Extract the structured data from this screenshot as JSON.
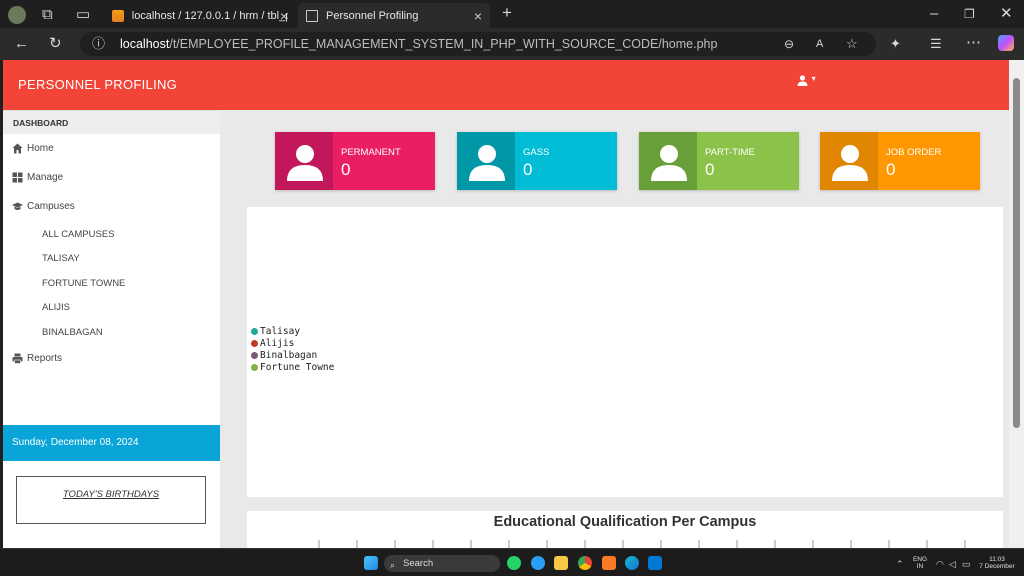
{
  "browser": {
    "tabs": [
      {
        "title": "localhost / 127.0.0.1 / hrm / tbl_p"
      },
      {
        "title": "Personnel Profiling"
      }
    ],
    "url_host": "localhost",
    "url_path": "/t/EMPLOYEE_PROFILE_MANAGEMENT_SYSTEM_IN_PHP_WITH_SOURCE_CODE/home.php"
  },
  "navbar": {
    "brand": "PERSONNEL PROFILING",
    "user_icon": "user-icon",
    "caret": "▾"
  },
  "sidebar": {
    "header": "DASHBOARD",
    "items": [
      {
        "label": "Home",
        "icon": "home-icon"
      },
      {
        "label": "Manage",
        "icon": "grid-icon"
      },
      {
        "label": "Campuses",
        "icon": "graduation-cap-icon"
      }
    ],
    "campuses": [
      "ALL CAMPUSES",
      "TALISAY",
      "FORTUNE TOWNE",
      "ALIJIS",
      "BINALBAGAN"
    ],
    "reports": {
      "label": "Reports",
      "icon": "printer-icon"
    },
    "date": "Sunday, December 08, 2024",
    "birthdays_label": "TODAY'S BIRTHDAYS"
  },
  "cards": [
    {
      "label": "PERMANENT",
      "count": "0",
      "color": "#e91e63",
      "dark": "#c2185b"
    },
    {
      "label": "GASS",
      "count": "0",
      "color": "#00bcd4",
      "dark": "#0097a7"
    },
    {
      "label": "PART-TIME",
      "count": "0",
      "color": "#8bc34a",
      "dark": "#689f38"
    },
    {
      "label": "JOB ORDER",
      "count": "0",
      "color": "#ff9800",
      "dark": "#e08600"
    }
  ],
  "chart1_legend": [
    {
      "name": "Talisay",
      "color": "#26a69a"
    },
    {
      "name": "Alijis",
      "color": "#c0392b"
    },
    {
      "name": "Binalbagan",
      "color": "#7b5a7a"
    },
    {
      "name": "Fortune Towne",
      "color": "#7cb342"
    }
  ],
  "chart_data": {
    "type": "bar",
    "title": "Educational Qualification Per Campus",
    "series": [],
    "categories": []
  },
  "taskbar": {
    "search_label": "Search",
    "lang_line1": "ENG",
    "lang_line2": "IN",
    "time": "11:03",
    "date": "7 December"
  }
}
